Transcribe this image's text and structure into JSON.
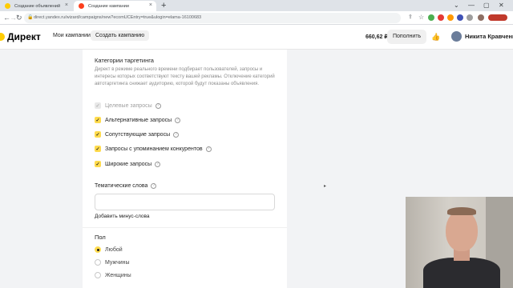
{
  "browser": {
    "tabs": [
      {
        "title": "Создание объявлений",
        "active": false
      },
      {
        "title": "Создание кампании",
        "active": true
      }
    ],
    "new_tab": "+",
    "window_controls": [
      "⌄",
      "—",
      "▢",
      "✕"
    ],
    "url": "direct.yandex.ru/wizard/campaigns/new?ecomUCEntry=true&ulogin=elama-16100683"
  },
  "header": {
    "logo_text": "Директ",
    "nav": [
      {
        "label": "Мои кампании",
        "active": false
      },
      {
        "label": "Создать кампанию",
        "active": true
      }
    ],
    "balance": "660,62 ₽",
    "topup_label": "Пополнить",
    "user_name": "Никита Кравченко"
  },
  "targeting": {
    "title": "Категории таргетинга",
    "description": "Директ в режиме реального времени подбирает пользователей, запросы и интересы которых соответствуют тексту вашей рекламы. Отключение категорий автотаргетинга снижает аудиторию, которой будут показаны объявления.",
    "categories": [
      {
        "label": "Целевые запросы",
        "checked": true,
        "disabled": true
      },
      {
        "label": "Альтернативные запросы",
        "checked": true,
        "disabled": false
      },
      {
        "label": "Сопутствующие запросы",
        "checked": true,
        "disabled": false
      },
      {
        "label": "Запросы с упоминанием конкурентов",
        "checked": true,
        "disabled": false
      },
      {
        "label": "Широкие запросы",
        "checked": true,
        "disabled": false
      }
    ]
  },
  "keywords": {
    "title": "Тематические слова",
    "value": "",
    "minus_link": "Добавить минус-слова"
  },
  "gender": {
    "title": "Пол",
    "options": [
      {
        "label": "Любой",
        "selected": true
      },
      {
        "label": "Мужчины",
        "selected": false
      },
      {
        "label": "Женщины",
        "selected": false
      }
    ]
  },
  "colors": {
    "accent": "#ffdb4d",
    "brand_red": "#fc3f1d"
  }
}
